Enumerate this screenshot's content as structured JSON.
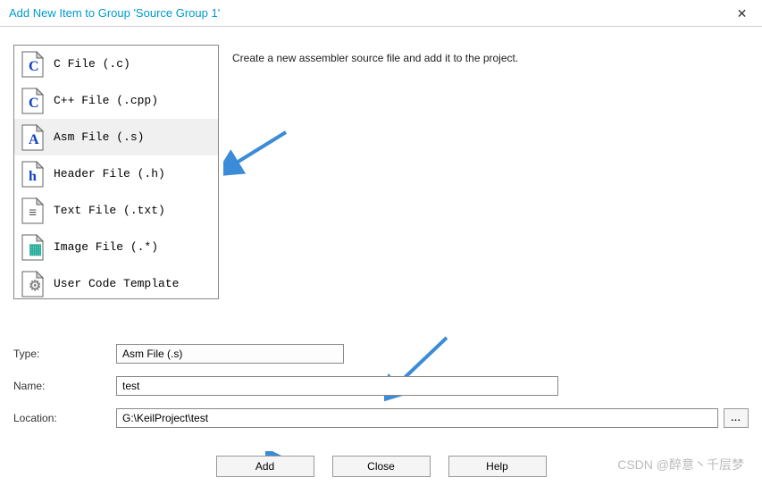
{
  "window": {
    "title": "Add New Item to Group 'Source Group 1'",
    "close_symbol": "✕"
  },
  "file_types": [
    {
      "label": "C File (.c)",
      "icon": "c-file-icon",
      "letter": "C",
      "color": "#1040c0"
    },
    {
      "label": "C++ File (.cpp)",
      "icon": "cpp-file-icon",
      "letter": "C",
      "color": "#1040c0"
    },
    {
      "label": "Asm File (.s)",
      "icon": "asm-file-icon",
      "letter": "A",
      "color": "#1040c0",
      "selected": true
    },
    {
      "label": "Header File (.h)",
      "icon": "header-file-icon",
      "letter": "h",
      "color": "#1040c0"
    },
    {
      "label": "Text File (.txt)",
      "icon": "text-file-icon",
      "letter": "≡",
      "color": "#555"
    },
    {
      "label": "Image File (.*)",
      "icon": "image-file-icon",
      "letter": "▦",
      "color": "#2a9"
    },
    {
      "label": "User Code Template",
      "icon": "template-icon",
      "letter": "⚙",
      "color": "#888"
    }
  ],
  "description": "Create a new assembler source file and add it to the project.",
  "form": {
    "type_label": "Type:",
    "type_value": "Asm File (.s)",
    "name_label": "Name:",
    "name_value": "test",
    "location_label": "Location:",
    "location_value": "G:\\KeilProject\\test",
    "browse_label": "..."
  },
  "buttons": {
    "add": "Add",
    "close": "Close",
    "help": "Help"
  },
  "watermark": "CSDN @醉意丶千层梦"
}
